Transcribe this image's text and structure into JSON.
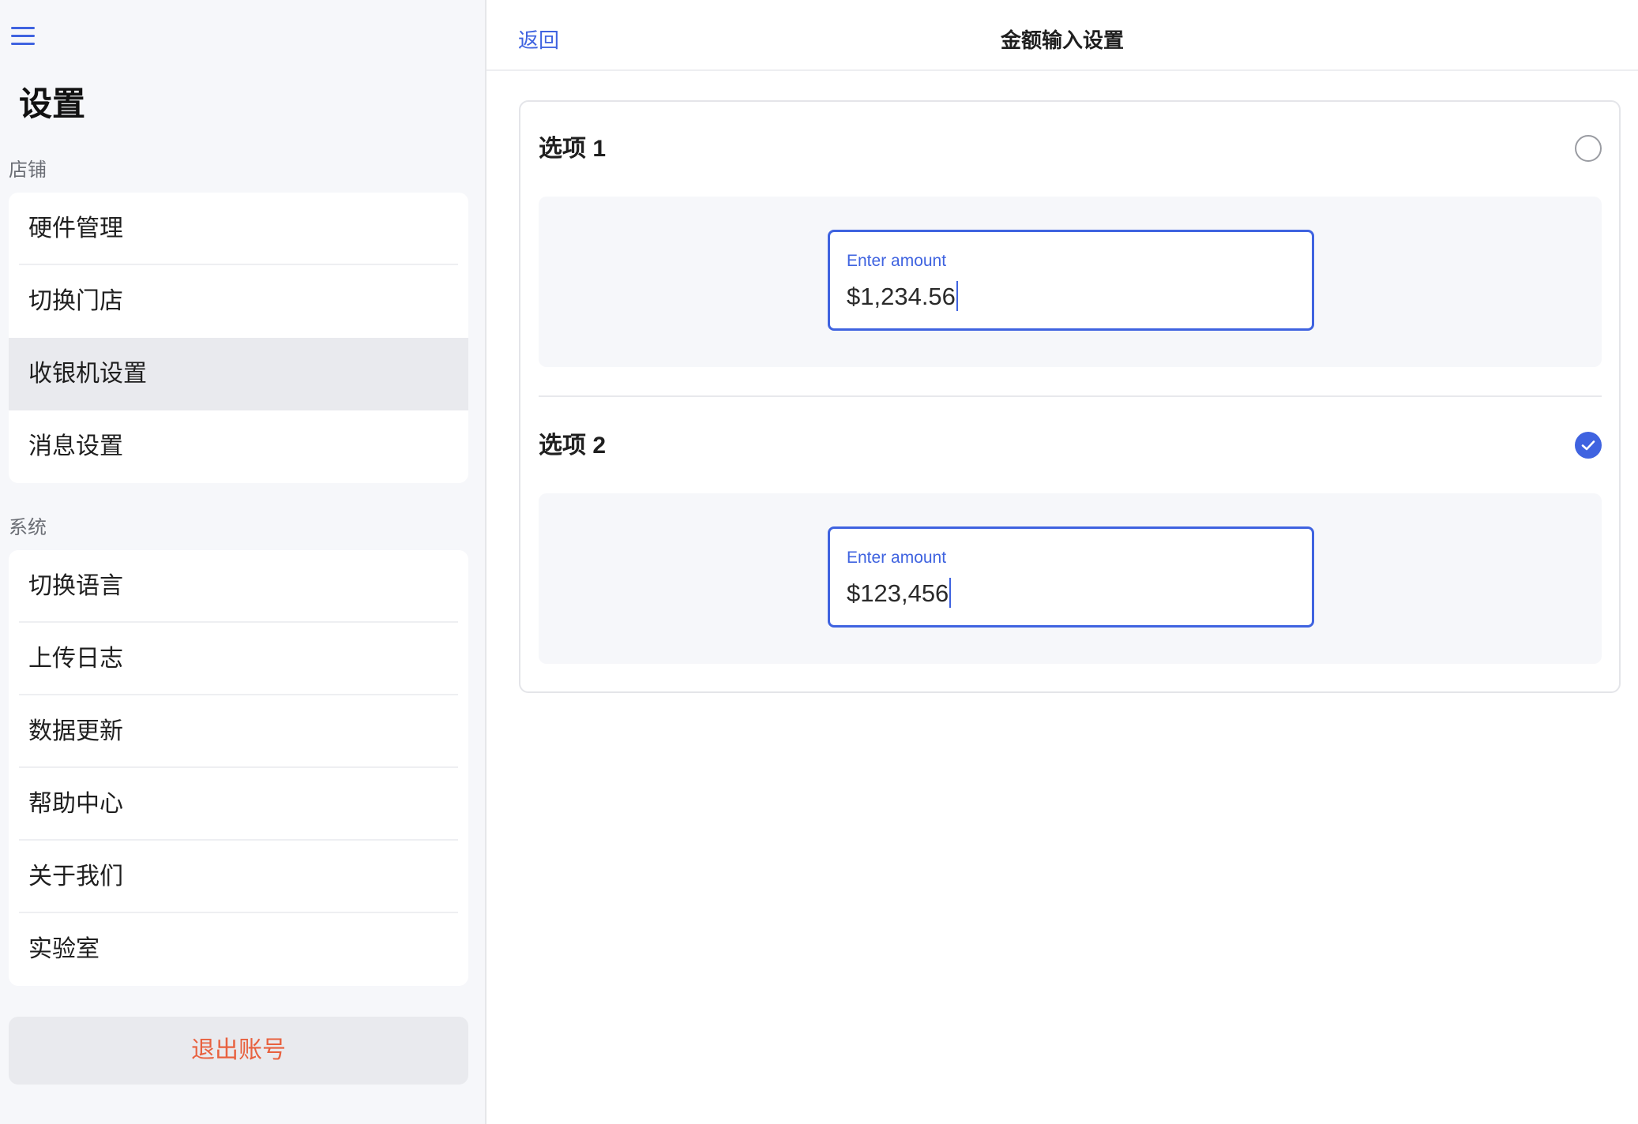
{
  "sidebar": {
    "title": "设置",
    "sections": [
      {
        "label": "店铺",
        "items": [
          "硬件管理",
          "切换门店",
          "收银机设置",
          "消息设置"
        ]
      },
      {
        "label": "系统",
        "items": [
          "切换语言",
          "上传日志",
          "数据更新",
          "帮助中心",
          "关于我们",
          "实验室"
        ]
      }
    ],
    "active_item": "收银机设置",
    "logout_label": "退出账号"
  },
  "header": {
    "back_label": "返回",
    "title": "金额输入设置"
  },
  "options": [
    {
      "label": "选项 1",
      "selected": false,
      "input_label": "Enter amount",
      "input_value": "$1,234.56"
    },
    {
      "label": "选项 2",
      "selected": true,
      "input_label": "Enter amount",
      "input_value": "$123,456"
    }
  ],
  "icons": {
    "menu": "menu-icon",
    "check": "checkmark-icon"
  },
  "colors": {
    "accent": "#3f63e0",
    "danger": "#e8613f",
    "sidebar_bg": "#f6f7fa",
    "active_bg": "#e9eaee"
  }
}
